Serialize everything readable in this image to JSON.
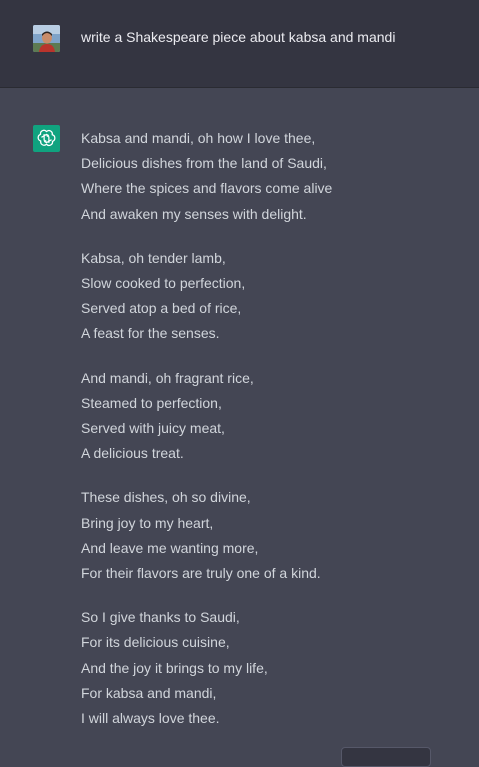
{
  "user": {
    "avatar_icon": "user-photo-avatar",
    "message": "write a Shakespeare piece about kabsa and mandi"
  },
  "assistant": {
    "avatar_icon": "openai-logo-icon",
    "brand_color": "#10a37f",
    "stanzas": [
      {
        "lines": [
          "Kabsa and mandi, oh how I love thee,",
          "Delicious dishes from the land of Saudi,",
          "Where the spices and flavors come alive",
          "And awaken my senses with delight."
        ]
      },
      {
        "lines": [
          "Kabsa, oh tender lamb,",
          "Slow cooked to perfection,",
          "Served atop a bed of rice,",
          "A feast for the senses."
        ]
      },
      {
        "lines": [
          "And mandi, oh fragrant rice,",
          "Steamed to perfection,",
          "Served with juicy meat,",
          "A delicious treat."
        ]
      },
      {
        "lines": [
          "These dishes, oh so divine,",
          "Bring joy to my heart,",
          "And leave me wanting more,",
          "For their flavors are truly one of a kind."
        ]
      },
      {
        "lines": [
          "So I give thanks to Saudi,",
          "For its delicious cuisine,",
          "And the joy it brings to my life,",
          "For kabsa and mandi,",
          "I will always love thee."
        ]
      }
    ]
  },
  "colors": {
    "user_bg": "#343541",
    "assistant_bg": "#444654",
    "user_text": "#ececf1",
    "assistant_text": "#d1d5db"
  }
}
